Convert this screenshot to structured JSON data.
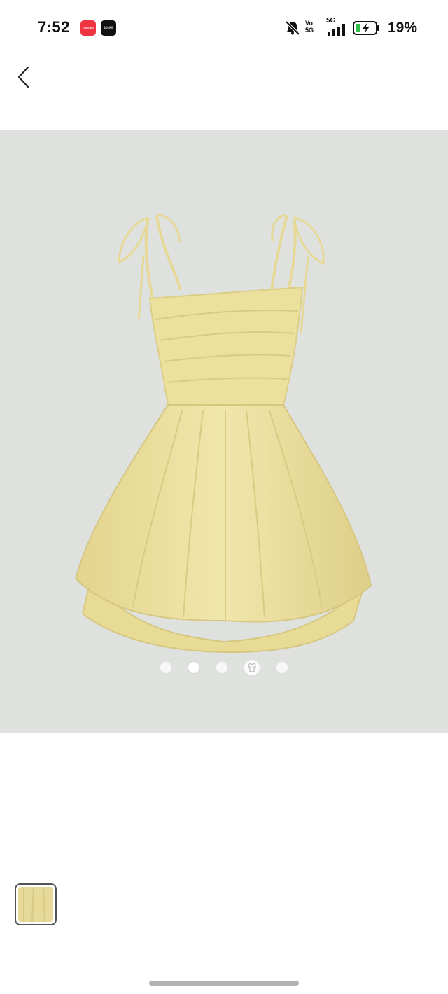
{
  "status_bar": {
    "time": "7:52",
    "app_badges": [
      {
        "name": "red-app-badge",
        "text": "zomato",
        "color": "#ef3340"
      },
      {
        "name": "black-app-badge",
        "text": "blinkit",
        "color": "#111111"
      }
    ],
    "icons": [
      "mute-bell-icon",
      "volte-icon",
      "5g-signal-icon",
      "battery-charging-icon"
    ],
    "network_label": "5G",
    "volte_label": "Vo 5G",
    "battery_percent": "19%"
  },
  "header": {
    "back_icon": "chevron-left-icon"
  },
  "product_image": {
    "background": "#dfe1de",
    "dress_color": "#ece09f",
    "carousel": {
      "count": 5,
      "active_index": 1,
      "special_index": 3
    }
  },
  "thumbnails": [
    {
      "name": "thumbnail-1",
      "selected": true
    }
  ]
}
